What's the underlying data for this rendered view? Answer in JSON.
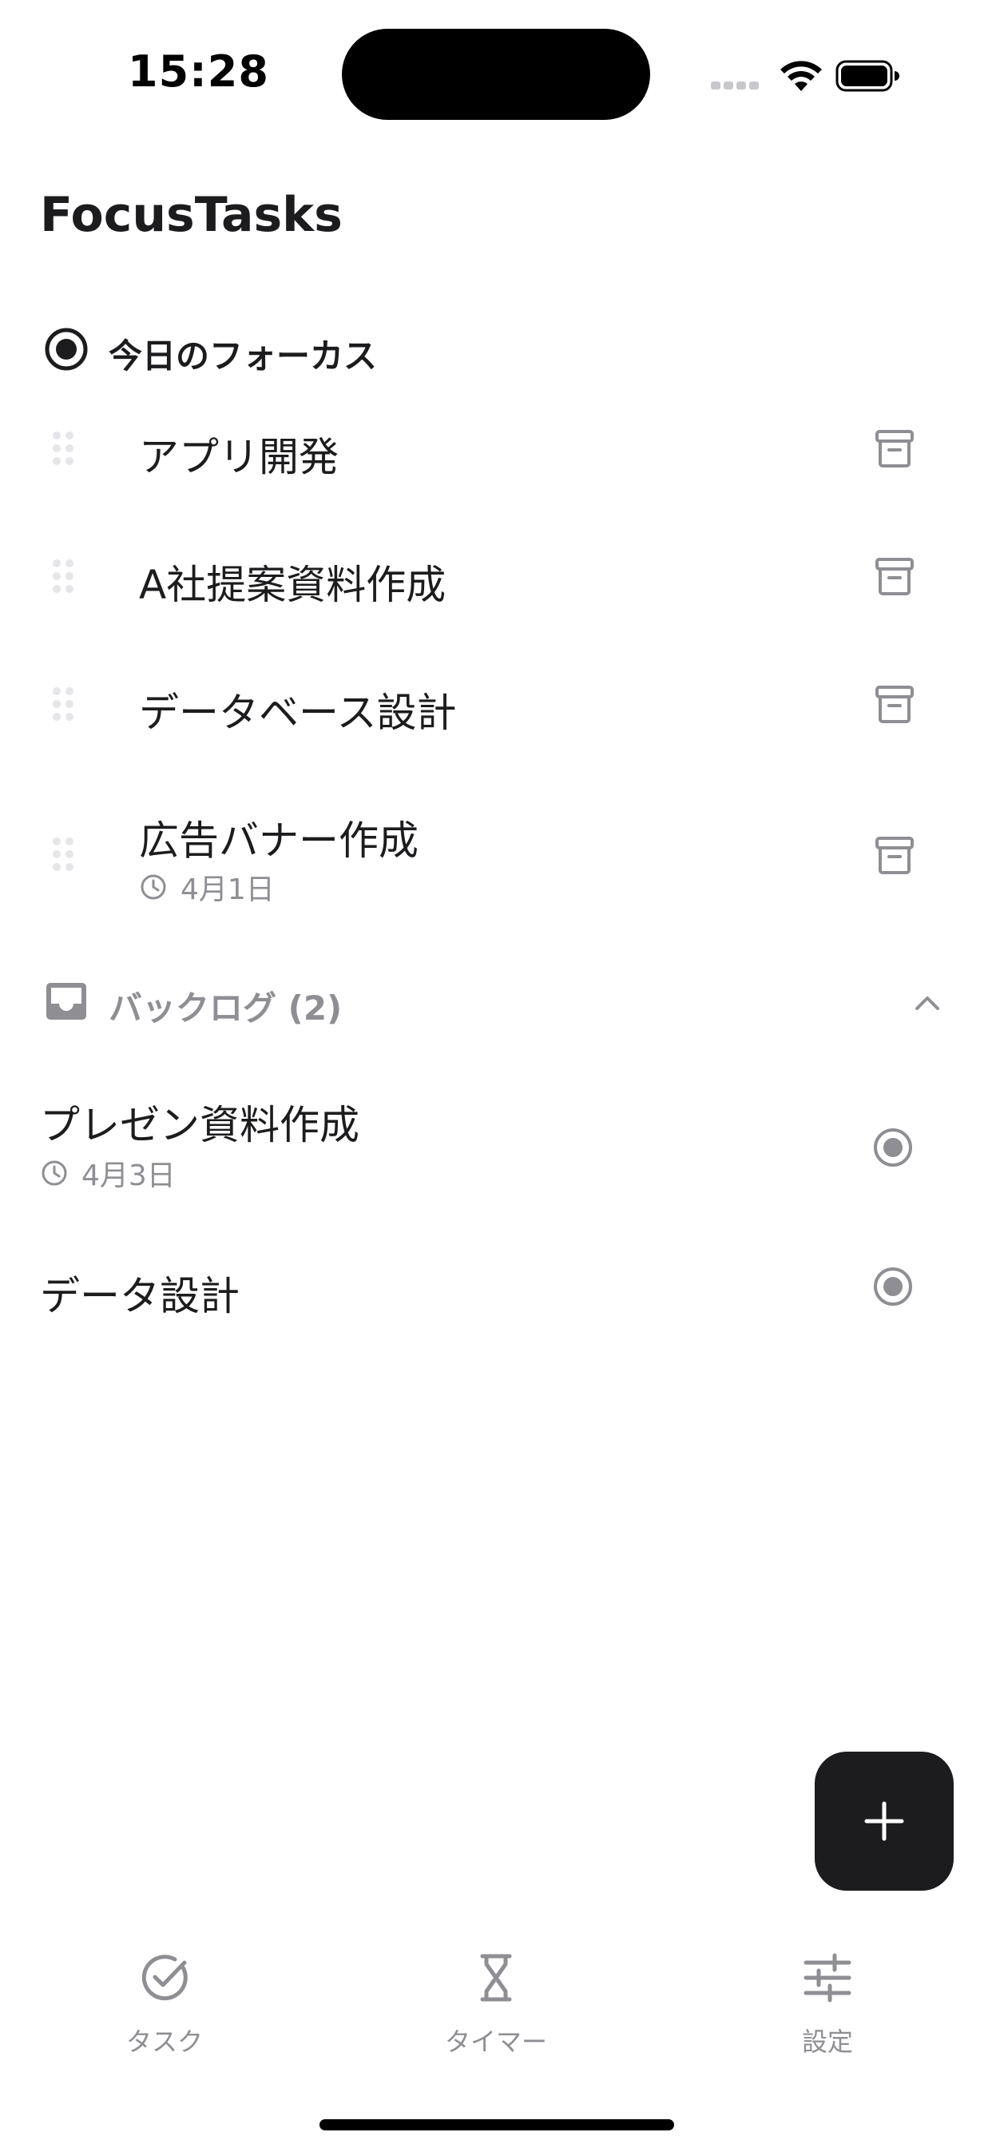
{
  "status_bar": {
    "time": "15:28"
  },
  "app": {
    "title": "FocusTasks"
  },
  "focus_section": {
    "label": "今日のフォーカス",
    "icon": "target-icon",
    "tasks": [
      {
        "title": "アプリ開発",
        "date": ""
      },
      {
        "title": "A社提案資料作成",
        "date": ""
      },
      {
        "title": "データベース設計",
        "date": ""
      },
      {
        "title": "広告バナー作成",
        "date": "4月1日"
      }
    ]
  },
  "backlog_section": {
    "label": "バックログ (2)",
    "icon": "inbox-icon",
    "tasks": [
      {
        "title": "プレゼン資料作成",
        "date": "4月3日"
      },
      {
        "title": "データ設計",
        "date": ""
      }
    ]
  },
  "fab": {
    "icon": "plus-icon"
  },
  "tab_bar": {
    "items": [
      {
        "label": "タスク",
        "icon": "check-circle-icon"
      },
      {
        "label": "タイマー",
        "icon": "hourglass-icon"
      },
      {
        "label": "設定",
        "icon": "sliders-icon"
      }
    ]
  },
  "colors": {
    "primary_text": "#1c1c1e",
    "secondary_text": "#8e8e93",
    "icon_gray": "#8e8e93",
    "fab_background": "#1c1c1e",
    "drag_handle": "#e5e5ea"
  }
}
